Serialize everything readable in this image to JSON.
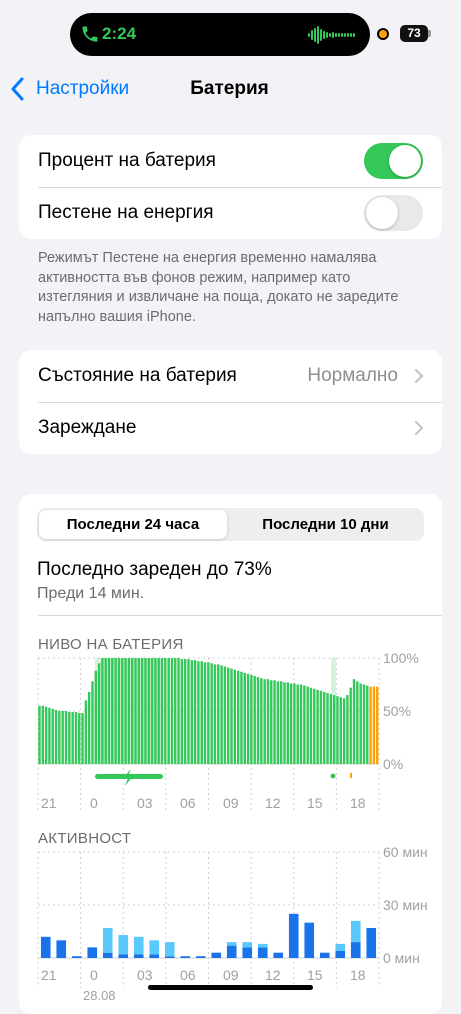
{
  "status_bar": {
    "call_time": "2:24",
    "battery_level": "73"
  },
  "nav": {
    "back_label": "Настройки",
    "title": "Батерия"
  },
  "toggles": [
    {
      "label": "Процент на батерия",
      "on": true
    },
    {
      "label": "Пестене на енергия",
      "on": false
    }
  ],
  "low_power_note": "Режимът Пестене на енергия временно намалява активността във фонов режим, например като изтегляния и извличане на поща, докато не заредите напълно вашия iPhone.",
  "menu": {
    "health_label": "Състояние на батерия",
    "health_value": "Нормално",
    "charging_label": "Зареждане"
  },
  "usage": {
    "tabs": [
      "Последни 24 часа",
      "Последни 10 дни"
    ],
    "selected_tab": 0,
    "last_charged": "Последно зареден до 73%",
    "last_charged_ago": "Преди 14 мин.",
    "battery_level_label": "НИВО НА БАТЕРИЯ",
    "activity_label": "АКТИВНОСТ",
    "date_label": "28.08"
  },
  "colors": {
    "accent": "#007aff",
    "green": "#34c759",
    "orange": "#ff9f0a",
    "dark_blue": "#1a73e8",
    "light_blue": "#5ac8fa"
  },
  "chart_data": [
    {
      "type": "bar",
      "title": "НИВО НА БАТЕРИЯ",
      "x_tick_labels": [
        "21",
        "0",
        "03",
        "06",
        "09",
        "12",
        "15",
        "18"
      ],
      "y_tick_labels": [
        "100%",
        "50%",
        "0%"
      ],
      "ylim": [
        0,
        100
      ],
      "grid": true,
      "series": [
        {
          "values": [
            55,
            55,
            54,
            53,
            52,
            51,
            50,
            50,
            50,
            49,
            49,
            49,
            48,
            48,
            60,
            68,
            78,
            88,
            95,
            100,
            100,
            100,
            100,
            100,
            100,
            100,
            100,
            100,
            100,
            100,
            100,
            100,
            100,
            100,
            100,
            100,
            100,
            100,
            100,
            100,
            100,
            100,
            100,
            99,
            99,
            99,
            98,
            98,
            97,
            97,
            96,
            96,
            95,
            94,
            94,
            93,
            92,
            91,
            90,
            89,
            88,
            87,
            86,
            85,
            84,
            83,
            82,
            81,
            80,
            80,
            79,
            79,
            78,
            78,
            77,
            77,
            76,
            76,
            75,
            75,
            74,
            73,
            72,
            71,
            70,
            69,
            68,
            67,
            66,
            65,
            64,
            63,
            62,
            65,
            72,
            80,
            78,
            76,
            75,
            74,
            73,
            73,
            73
          ]
        }
      ],
      "charging_hours": [
        "0–06",
        "18"
      ]
    },
    {
      "type": "bar",
      "title": "АКТИВНОСТ",
      "x_tick_labels": [
        "21",
        "0",
        "03",
        "06",
        "09",
        "12",
        "15",
        "18"
      ],
      "y_tick_labels": [
        "60 мин",
        "30 мин",
        "0 мин"
      ],
      "ylim": [
        0,
        60
      ],
      "grid": true,
      "series": [
        {
          "name": "screen_on",
          "values": [
            12,
            10,
            1,
            6,
            3,
            2,
            2,
            2,
            1,
            1,
            1,
            3,
            7,
            6,
            6,
            3,
            25,
            20,
            3,
            4,
            9,
            17
          ]
        },
        {
          "name": "screen_off",
          "values": [
            0,
            0,
            0,
            0,
            14,
            11,
            10,
            8,
            8,
            0,
            0,
            0,
            2,
            3,
            2,
            0,
            0,
            0,
            0,
            4,
            12,
            0
          ]
        }
      ]
    }
  ]
}
